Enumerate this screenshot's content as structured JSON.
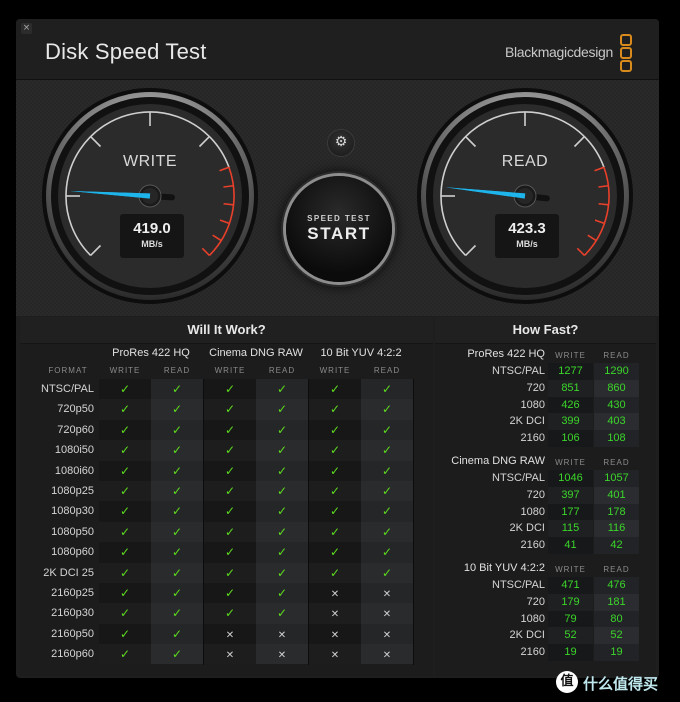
{
  "window": {
    "close_icon": "×",
    "title": "Disk Speed Test",
    "brand": "Blackmagicdesign"
  },
  "gauges": {
    "write": {
      "label": "WRITE",
      "value": "419.0",
      "unit": "MB/s",
      "needle_fraction": 0.18
    },
    "read": {
      "label": "READ",
      "value": "423.3",
      "unit": "MB/s",
      "needle_fraction": 0.19
    }
  },
  "controls": {
    "settings_icon": "⚙",
    "start_small": "SPEED TEST",
    "start_big": "START"
  },
  "colors": {
    "needle": "#1eb4ec",
    "redline": "#e8402a",
    "check": "#5ddc1e",
    "speed_value": "#3bd62a",
    "brand_logo": "#d88a1c"
  },
  "will_it_work": {
    "title": "Will It Work?",
    "format_label": "FORMAT",
    "write_label": "WRITE",
    "read_label": "READ",
    "codecs": [
      "ProRes 422 HQ",
      "Cinema DNG RAW",
      "10 Bit YUV 4:2:2"
    ],
    "rows": [
      {
        "format": "NTSC/PAL",
        "results": [
          true,
          true,
          true,
          true,
          true,
          true
        ]
      },
      {
        "format": "720p50",
        "results": [
          true,
          true,
          true,
          true,
          true,
          true
        ]
      },
      {
        "format": "720p60",
        "results": [
          true,
          true,
          true,
          true,
          true,
          true
        ]
      },
      {
        "format": "1080i50",
        "results": [
          true,
          true,
          true,
          true,
          true,
          true
        ]
      },
      {
        "format": "1080i60",
        "results": [
          true,
          true,
          true,
          true,
          true,
          true
        ]
      },
      {
        "format": "1080p25",
        "results": [
          true,
          true,
          true,
          true,
          true,
          true
        ]
      },
      {
        "format": "1080p30",
        "results": [
          true,
          true,
          true,
          true,
          true,
          true
        ]
      },
      {
        "format": "1080p50",
        "results": [
          true,
          true,
          true,
          true,
          true,
          true
        ]
      },
      {
        "format": "1080p60",
        "results": [
          true,
          true,
          true,
          true,
          true,
          true
        ]
      },
      {
        "format": "2K DCI 25",
        "results": [
          true,
          true,
          true,
          true,
          true,
          true
        ]
      },
      {
        "format": "2160p25",
        "results": [
          true,
          true,
          true,
          true,
          false,
          false
        ]
      },
      {
        "format": "2160p30",
        "results": [
          true,
          true,
          true,
          true,
          false,
          false
        ]
      },
      {
        "format": "2160p50",
        "results": [
          true,
          true,
          false,
          false,
          false,
          false
        ]
      },
      {
        "format": "2160p60",
        "results": [
          true,
          true,
          false,
          false,
          false,
          false
        ]
      }
    ],
    "check_glyph": "✓",
    "cross_glyph": "✕"
  },
  "how_fast": {
    "title": "How Fast?",
    "write_label": "WRITE",
    "read_label": "READ",
    "sections": [
      {
        "codec": "ProRes 422 HQ",
        "rows": [
          {
            "format": "NTSC/PAL",
            "write": "1277",
            "read": "1290"
          },
          {
            "format": "720",
            "write": "851",
            "read": "860"
          },
          {
            "format": "1080",
            "write": "426",
            "read": "430"
          },
          {
            "format": "2K DCI",
            "write": "399",
            "read": "403"
          },
          {
            "format": "2160",
            "write": "106",
            "read": "108"
          }
        ]
      },
      {
        "codec": "Cinema DNG RAW",
        "rows": [
          {
            "format": "NTSC/PAL",
            "write": "1046",
            "read": "1057"
          },
          {
            "format": "720",
            "write": "397",
            "read": "401"
          },
          {
            "format": "1080",
            "write": "177",
            "read": "178"
          },
          {
            "format": "2K DCI",
            "write": "115",
            "read": "116"
          },
          {
            "format": "2160",
            "write": "41",
            "read": "42"
          }
        ]
      },
      {
        "codec": "10 Bit YUV 4:2:2",
        "rows": [
          {
            "format": "NTSC/PAL",
            "write": "471",
            "read": "476"
          },
          {
            "format": "720",
            "write": "179",
            "read": "181"
          },
          {
            "format": "1080",
            "write": "79",
            "read": "80"
          },
          {
            "format": "2K DCI",
            "write": "52",
            "read": "52"
          },
          {
            "format": "2160",
            "write": "19",
            "read": "19"
          }
        ]
      }
    ]
  },
  "watermark": {
    "icon": "值",
    "text": "什么值得买"
  }
}
